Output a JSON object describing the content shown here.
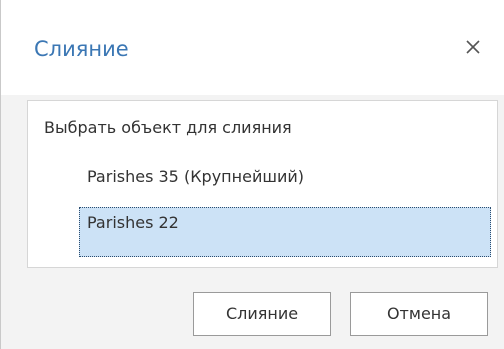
{
  "dialog": {
    "title": "Слияние",
    "close_icon": "close-icon"
  },
  "list": {
    "header": "Выбрать объект для слияния",
    "items": [
      {
        "label": "Parishes 35 (Крупнейший)",
        "selected": false
      },
      {
        "label": "Parishes 22",
        "selected": true
      }
    ]
  },
  "buttons": {
    "merge_label": "Слияние",
    "cancel_label": "Отмена"
  },
  "colors": {
    "title": "#3b77b4",
    "selection": "#cce2f6"
  }
}
